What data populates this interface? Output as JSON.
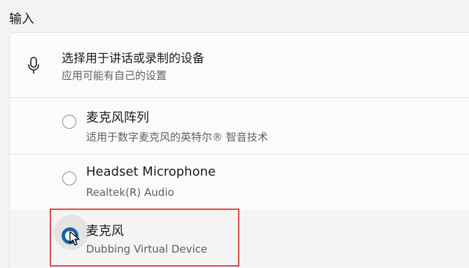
{
  "section_title": "输入",
  "header": {
    "title": "选择用于讲话或录制的设备",
    "subtitle": "应用可能有自己的设置",
    "icon": "microphone-icon"
  },
  "devices": [
    {
      "name": "麦克风阵列",
      "description": "适用于数字麦克风的英特尔® 智音技术",
      "selected": false
    },
    {
      "name": "Headset Microphone",
      "description": "Realtek(R) Audio",
      "selected": false
    },
    {
      "name": "麦克风",
      "description": "Dubbing Virtual Device",
      "selected": true
    }
  ],
  "colors": {
    "accent": "#1d5fa8",
    "highlight_annotation": "#d94a4a"
  }
}
